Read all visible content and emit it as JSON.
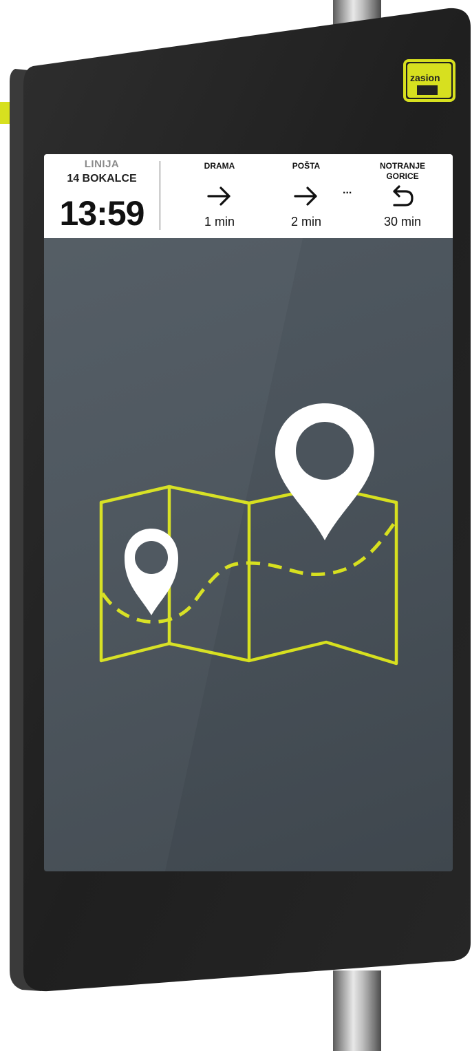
{
  "brand": {
    "logo_text": "zasion",
    "accent_color": "#d7e01f"
  },
  "header": {
    "line_label": "LINIJA",
    "line_name": "14 BOKALCE",
    "clock": "13:59"
  },
  "stops": [
    {
      "name": "DRAMA",
      "time": "1 min",
      "arrow": "arrow-right-icon"
    },
    {
      "name": "POŠTA",
      "time": "2 min",
      "arrow": "arrow-right-icon"
    },
    {
      "name": "NOTRANJE GORICE",
      "time": "30 min",
      "arrow": "return-arrow-icon"
    }
  ],
  "ellipsis": "...",
  "colors": {
    "screen_bg": "#4b545c",
    "device_body": "#222222",
    "map_line": "#d7e01f",
    "pin": "#ffffff"
  }
}
